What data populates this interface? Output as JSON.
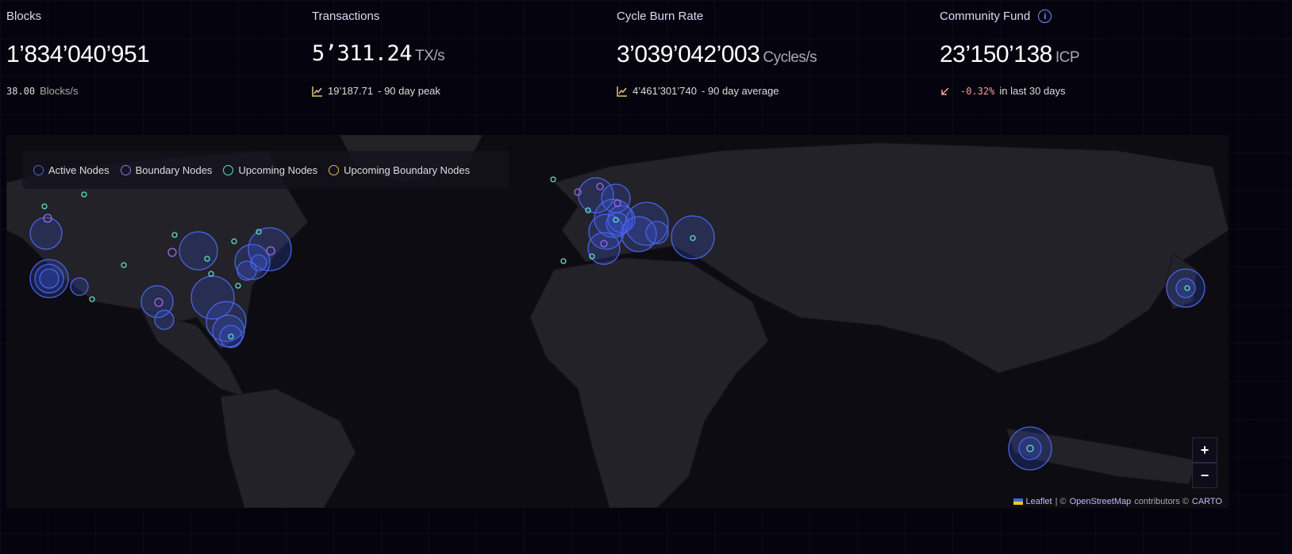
{
  "stats": [
    {
      "label": "Blocks",
      "value": "1’834’040’951",
      "unit": "",
      "sub_value": "38.00",
      "sub_text": "Blocks/s"
    },
    {
      "label": "Transactions",
      "value": "5’311.24",
      "unit": "TX/s",
      "sub_value": "19’187.71",
      "sub_text": "- 90 day peak",
      "icon": "chart-line-icon"
    },
    {
      "label": "Cycle Burn Rate",
      "value": "3’039’042’003",
      "unit": "Cycles/s",
      "sub_value": "4’461’301’740",
      "sub_text": "- 90 day average",
      "icon": "chart-line-icon"
    },
    {
      "label": "Community Fund",
      "value": "23’150’138",
      "unit": "ICP",
      "sub_value": "-0.32%",
      "sub_text": "in last 30 days",
      "icon": "arrow-down-left-icon"
    }
  ],
  "legend": [
    {
      "label": "Active Nodes",
      "color": "#4a63e6"
    },
    {
      "label": "Boundary Nodes",
      "color": "#9b6cf0"
    },
    {
      "label": "Upcoming Nodes",
      "color": "#5ee0c8"
    },
    {
      "label": "Upcoming Boundary Nodes",
      "color": "#f0b84a"
    }
  ],
  "map": {
    "zoom_in": "+",
    "zoom_out": "−",
    "attribution": {
      "leaflet": "Leaflet",
      "sep": "| ©",
      "osm": "OpenStreetMap",
      "contrib": "contributors ©",
      "carto": "CARTO"
    }
  }
}
